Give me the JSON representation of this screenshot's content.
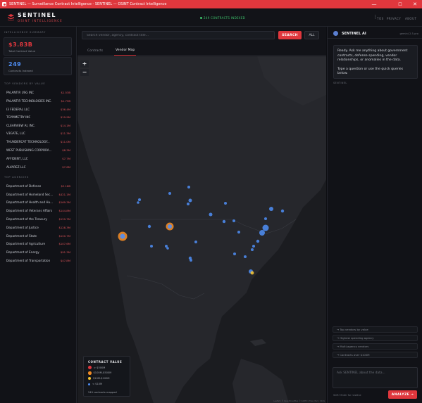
{
  "window": {
    "title": "SENTINEL — Surveillance Contract Intelligence - SENTINEL — OSINT Contract Intelligence",
    "minimize": "—",
    "maximize": "☐",
    "close": "✕"
  },
  "header": {
    "brand": "SENTINEL",
    "subtitle": "OSINT INTELLIGENCE",
    "indexed": "249 CONTRACTS INDEXED",
    "links": [
      "TOS",
      "PRIVACY",
      "ABOUT"
    ],
    "menu_icon": "more-vertical-icon"
  },
  "sidebar": {
    "summary_label": "INTELLIGENCE SUMMARY",
    "stats": [
      {
        "value": "$3.83B",
        "label": "Total Contract Value",
        "color": "#e0373d"
      },
      {
        "value": "249",
        "label": "Contracts Indexed",
        "color": "#4f8ff7"
      }
    ],
    "vendors_label": "TOP VENDORS BY VALUE",
    "vendors": [
      {
        "name": "PALANTIR USG INC",
        "amount": "$1.53B"
      },
      {
        "name": "PALANTIR TECHNOLOGIES INC.",
        "amount": "$1.75B"
      },
      {
        "name": "I3 FEDERAL LLC",
        "amount": "$36.4M"
      },
      {
        "name": "TGYMMETRY INC",
        "amount": "$19.9M"
      },
      {
        "name": "CLEARVIEW AI, INC.",
        "amount": "$14.1M"
      },
      {
        "name": "V3GATE, LLC",
        "amount": "$11.3M"
      },
      {
        "name": "THUNDERCAT TECHNOLOGY...",
        "amount": "$11.0M"
      },
      {
        "name": "WEST PUBLISHING CORPORA...",
        "amount": "$8.3M"
      },
      {
        "name": "AFFIDENT, LLC",
        "amount": "$7.7M"
      },
      {
        "name": "ALVAREZ LLC",
        "amount": "$7.6M"
      }
    ],
    "agencies_label": "TOP AGENCIES",
    "agencies": [
      {
        "name": "Department of Defense",
        "amount": "$2.18B"
      },
      {
        "name": "Department of Homeland Sec...",
        "amount": "$421.1M"
      },
      {
        "name": "Department of Health and Hu...",
        "amount": "$169.3M"
      },
      {
        "name": "Department of Veterans Affairs",
        "amount": "$144.8M"
      },
      {
        "name": "Department of the Treasury",
        "amount": "$129.7M"
      },
      {
        "name": "Department of Justice",
        "amount": "$128.3M"
      },
      {
        "name": "Department of State",
        "amount": "$120.7M"
      },
      {
        "name": "Department of Agriculture",
        "amount": "$107.6M"
      },
      {
        "name": "Department of Energy",
        "amount": "$91.3M"
      },
      {
        "name": "Department of Transportation",
        "amount": "$47.8M"
      }
    ]
  },
  "search": {
    "placeholder": "Search vendor, agency, contract title...",
    "search_label": "SEARCH",
    "all_label": "ALL"
  },
  "tabs": [
    {
      "label": "Contracts",
      "active": false
    },
    {
      "label": "Vendor Map",
      "active": true
    }
  ],
  "map": {
    "zoom_in": "+",
    "zoom_out": "−",
    "legend": {
      "title": "CONTRACT VALUE",
      "items": [
        {
          "label": "> $500M",
          "color": "#e0373d"
        },
        {
          "label": "$100M-$500M",
          "color": "#f08a24"
        },
        {
          "label": "$10M-$100M",
          "color": "#f2c232"
        },
        {
          "label": "< $10M",
          "color": "#4f8ff7"
        }
      ],
      "footer": "249 contracts mapped"
    },
    "attribution": "Leaflet | © OpenStreetMap © CARTO | Tiles: Esri | USGS"
  },
  "ai": {
    "title": "SENTINEL AI",
    "model": "gemini-2.5-pro",
    "message_1": "Ready. Ask me anything about government contracts, defense spending, vendor relationships, or anomalies in the data.",
    "message_2": "Type a question or use the quick queries below.",
    "role_label": "SENTINEL",
    "quick": [
      "→ Top vendors by value",
      "→ Highest spending agency",
      "→ Multi-agency vendors",
      "→ Contracts over $100M"
    ],
    "input_placeholder": "Ask SENTINEL about the data...",
    "hint": "Shift+Enter for newline",
    "analyze_label": "ANALYZE →"
  }
}
